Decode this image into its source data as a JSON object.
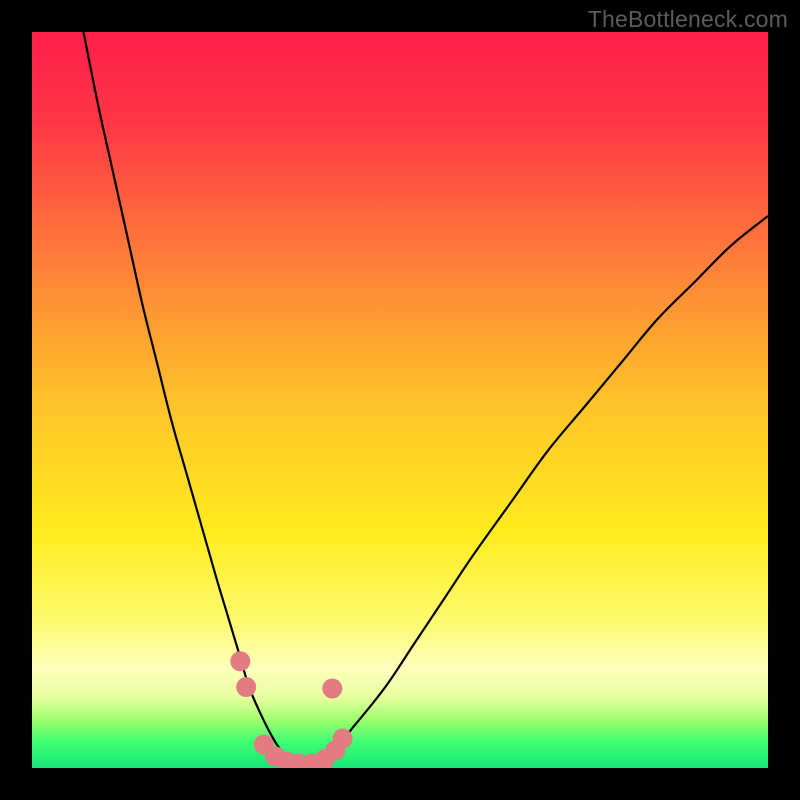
{
  "watermark": "TheBottleneck.com",
  "chart_data": {
    "type": "line",
    "title": "",
    "xlabel": "",
    "ylabel": "",
    "xlim": [
      0,
      100
    ],
    "ylim": [
      0,
      100
    ],
    "background_gradient": {
      "stops": [
        {
          "offset": 0.0,
          "color": "#ff1f4b"
        },
        {
          "offset": 0.12,
          "color": "#ff3546"
        },
        {
          "offset": 0.3,
          "color": "#ff7a3a"
        },
        {
          "offset": 0.5,
          "color": "#ffc22a"
        },
        {
          "offset": 0.68,
          "color": "#ffec1e"
        },
        {
          "offset": 0.8,
          "color": "#fdfb6e"
        },
        {
          "offset": 0.865,
          "color": "#ffffbe"
        },
        {
          "offset": 0.905,
          "color": "#e6ff9e"
        },
        {
          "offset": 0.935,
          "color": "#9dff6c"
        },
        {
          "offset": 0.965,
          "color": "#3eff72"
        },
        {
          "offset": 1.0,
          "color": "#18e47a"
        }
      ]
    },
    "series": [
      {
        "name": "bottleneck-curve",
        "color": "#000000",
        "stroke_width": 2.2,
        "x": [
          7,
          9,
          11,
          13,
          15,
          17,
          19,
          21,
          23,
          25,
          26.5,
          28,
          29.5,
          31,
          32.5,
          34,
          36,
          38,
          41,
          44,
          48,
          52,
          56,
          60,
          65,
          70,
          75,
          80,
          85,
          90,
          95,
          100
        ],
        "y": [
          100,
          90,
          81,
          72,
          63,
          55,
          47,
          40,
          33,
          26,
          21,
          16,
          11,
          7.5,
          4.5,
          2.2,
          0.7,
          0.7,
          2.5,
          6,
          11,
          17,
          23,
          29,
          36,
          43,
          49,
          55,
          61,
          66,
          71,
          75
        ]
      }
    ],
    "markers": {
      "name": "highlight-points",
      "color": "#e37b82",
      "radius": 10,
      "points": [
        {
          "x": 28.3,
          "y": 14.5
        },
        {
          "x": 29.1,
          "y": 11.0
        },
        {
          "x": 31.5,
          "y": 3.2
        },
        {
          "x": 33.0,
          "y": 1.6
        },
        {
          "x": 34.5,
          "y": 0.9
        },
        {
          "x": 36.2,
          "y": 0.6
        },
        {
          "x": 38.0,
          "y": 0.6
        },
        {
          "x": 39.8,
          "y": 1.2
        },
        {
          "x": 41.2,
          "y": 2.4
        },
        {
          "x": 42.2,
          "y": 4.0
        },
        {
          "x": 40.8,
          "y": 10.8
        }
      ]
    }
  }
}
